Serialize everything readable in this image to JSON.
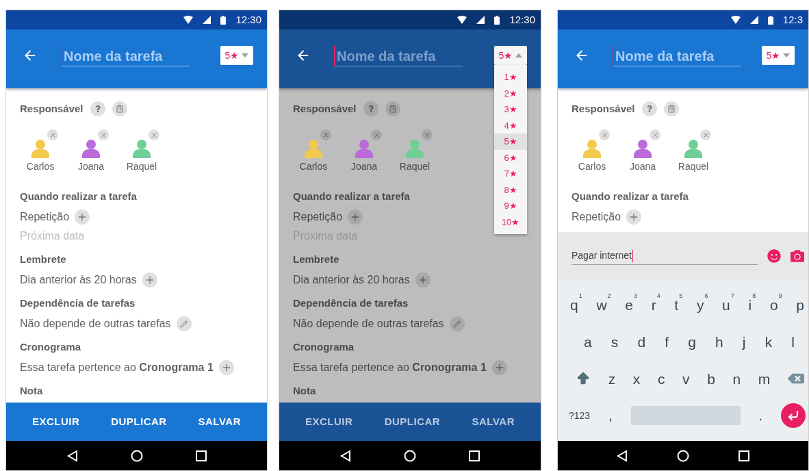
{
  "screens": [
    {
      "dimmed": false,
      "status": {
        "time": "12:30"
      },
      "header": {
        "title_placeholder": "Nome da tarefa",
        "priority": {
          "value": "5★",
          "expanded": false
        }
      },
      "responsible": {
        "label": "Responsável",
        "people": [
          {
            "name": "Carlos",
            "color": "#f2c94c"
          },
          {
            "name": "Joana",
            "color": "#bb6bd9"
          },
          {
            "name": "Raquel",
            "color": "#6fcf97"
          }
        ]
      },
      "sections": [
        {
          "title": "Quando realizar a tarefa",
          "rows": [
            {
              "kind": "add",
              "text": "Repetição"
            },
            {
              "kind": "hint",
              "text": "Próxima data"
            }
          ]
        },
        {
          "title": "Lembrete",
          "rows": [
            {
              "kind": "add",
              "text": "Dia anterior às 20 horas"
            }
          ]
        },
        {
          "title": "Dependência de tarefas",
          "rows": [
            {
              "kind": "edit",
              "text": "Não depende de outras tarefas"
            }
          ]
        },
        {
          "title": "Cronograma",
          "rows": [
            {
              "kind": "add",
              "text": "Essa tarefa pertence ao **Cronograma 1**"
            }
          ]
        },
        {
          "title": "Nota"
        }
      ],
      "actions": [
        "EXCLUIR",
        "DUPLICAR",
        "SALVAR"
      ]
    },
    {
      "dimmed": true,
      "status": {
        "time": "12:30"
      },
      "header": {
        "title_placeholder": "Nome da tarefa",
        "priority": {
          "value": "5★",
          "expanded": true
        }
      },
      "priority_menu": [
        {
          "label": "1★",
          "selected": false
        },
        {
          "label": "2★",
          "selected": false
        },
        {
          "label": "3★",
          "selected": false
        },
        {
          "label": "4★",
          "selected": false
        },
        {
          "label": "5★",
          "selected": true
        },
        {
          "label": "6★",
          "selected": false
        },
        {
          "label": "7★",
          "selected": false
        },
        {
          "label": "8★",
          "selected": false
        },
        {
          "label": "9★",
          "selected": false
        },
        {
          "label": "10★",
          "selected": false
        }
      ],
      "responsible": {
        "label": "Responsável",
        "people": [
          {
            "name": "Carlos",
            "color": "#f2c94c"
          },
          {
            "name": "Joana",
            "color": "#bb6bd9"
          },
          {
            "name": "Raquel",
            "color": "#6fcf97"
          }
        ]
      },
      "sections": [
        {
          "title": "Quando realizar a tarefa",
          "rows": [
            {
              "kind": "add",
              "text": "Repetição"
            },
            {
              "kind": "hint",
              "text": "Próxima data"
            }
          ]
        },
        {
          "title": "Lembrete",
          "rows": [
            {
              "kind": "add",
              "text": "Dia anterior às 20 horas"
            }
          ]
        },
        {
          "title": "Dependência de tarefas",
          "rows": [
            {
              "kind": "edit",
              "text": "Não depende de outras tarefas"
            }
          ]
        },
        {
          "title": "Cronograma",
          "rows": [
            {
              "kind": "add",
              "text": "Essa tarefa pertence ao **Cronograma 1**"
            }
          ]
        },
        {
          "title": "Nota"
        }
      ],
      "actions": [
        "EXCLUIR",
        "DUPLICAR",
        "SALVAR"
      ]
    },
    {
      "dimmed": false,
      "status": {
        "time": "12:3"
      },
      "header": {
        "title_placeholder": "Nome da tarefa",
        "priority": {
          "value": "5★",
          "expanded": false
        }
      },
      "responsible": {
        "label": "Responsável",
        "people": [
          {
            "name": "Carlos",
            "color": "#f2c94c"
          },
          {
            "name": "Joana",
            "color": "#bb6bd9"
          },
          {
            "name": "Raquel",
            "color": "#6fcf97"
          }
        ]
      },
      "sections": [
        {
          "title": "Quando realizar a tarefa",
          "rows": [
            {
              "kind": "add",
              "text": "Repetição"
            }
          ]
        }
      ],
      "composer": {
        "value": "Pagar internet"
      },
      "keyboard": [
        {
          "keys": [
            {
              "kind": "char",
              "label": "q",
              "hint": "1"
            },
            {
              "kind": "char",
              "label": "w",
              "hint": "2"
            },
            {
              "kind": "char",
              "label": "e",
              "hint": "3"
            },
            {
              "kind": "char",
              "label": "r",
              "hint": "4"
            },
            {
              "kind": "char",
              "label": "t",
              "hint": "5"
            },
            {
              "kind": "char",
              "label": "y",
              "hint": "6"
            },
            {
              "kind": "char",
              "label": "u",
              "hint": "7"
            },
            {
              "kind": "char",
              "label": "i",
              "hint": "8"
            },
            {
              "kind": "char",
              "label": "o",
              "hint": "9"
            },
            {
              "kind": "char",
              "label": "p"
            }
          ]
        },
        {
          "keys": [
            {
              "kind": "char",
              "label": "a"
            },
            {
              "kind": "char",
              "label": "s"
            },
            {
              "kind": "char",
              "label": "d"
            },
            {
              "kind": "char",
              "label": "f"
            },
            {
              "kind": "char",
              "label": "g"
            },
            {
              "kind": "char",
              "label": "h"
            },
            {
              "kind": "char",
              "label": "j"
            },
            {
              "kind": "char",
              "label": "k"
            },
            {
              "kind": "char",
              "label": "l"
            }
          ]
        },
        {
          "keys": [
            {
              "kind": "shift"
            },
            {
              "kind": "char",
              "label": "z"
            },
            {
              "kind": "char",
              "label": "x"
            },
            {
              "kind": "char",
              "label": "c"
            },
            {
              "kind": "char",
              "label": "v"
            },
            {
              "kind": "char",
              "label": "b"
            },
            {
              "kind": "char",
              "label": "n"
            },
            {
              "kind": "char",
              "label": "m"
            },
            {
              "kind": "backspace"
            }
          ]
        },
        {
          "keys": [
            {
              "kind": "char",
              "label": "?123"
            },
            {
              "kind": "char",
              "label": ","
            },
            {
              "kind": "space"
            },
            {
              "kind": "char",
              "label": "."
            },
            {
              "kind": "enter"
            }
          ]
        }
      ]
    }
  ]
}
